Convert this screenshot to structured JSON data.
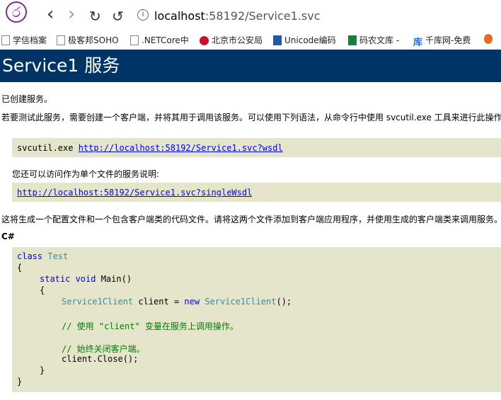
{
  "browser": {
    "logo_glyph": "ර",
    "back_icon": "‹",
    "forward_icon": "›",
    "reload_icon": "↻",
    "home_icon": "↺",
    "url_host": "localhost",
    "url_rest": ":58192/Service1.svc",
    "info_glyph": "i"
  },
  "bookmarks": [
    {
      "label": "学信档案",
      "icon": "doc"
    },
    {
      "label": "极客邦SOHO",
      "icon": "doc"
    },
    {
      "label": ".NETCore中",
      "icon": "doc"
    },
    {
      "label": "北京市公安局",
      "icon": "police"
    },
    {
      "label": "Unicode编码",
      "icon": "unicode"
    },
    {
      "label": "码农文库 -",
      "icon": "ma"
    },
    {
      "label": "千库网-免费",
      "icon": "qianku"
    }
  ],
  "page": {
    "title": "Service1 服务",
    "created": "已创建服务。",
    "instruction": "若要测试此服务，需要创建一个客户端，并将其用于调用该服务。可以使用下列语法，从命令行中使用 svcutil.exe 工具来进行此操作",
    "cmd_prefix": "svcutil.exe ",
    "wsdl_link": "http://localhost:58192/Service1.svc?wsdl",
    "single_note": "您还可以访问作为单个文件的服务说明:",
    "single_link": "http://localhost:58192/Service1.svc?singleWsdl",
    "generate_note": "这将生成一个配置文件和一个包含客户端类的代码文件。请将这两个文件添加到客户端应用程序，并使用生成的客户端类来调用服务。",
    "lang_heading": "C#"
  },
  "code": {
    "l1_kw": "class",
    "l1_ty": "Test",
    "l2": "{",
    "l3_kw": "static void",
    "l3_rest": " Main()",
    "l4": "{",
    "l5_ty": "Service1Client",
    "l5_mid": " client = ",
    "l5_kw": "new",
    "l5_ty2": "Service1Client",
    "l5_end": "();",
    "l6_cm": "// 使用 \"client\" 变量在服务上调用操作。",
    "l7_cm": "// 始终关闭客户端。",
    "l8": "client.Close();",
    "l9": "}",
    "l10": "}"
  },
  "colors": {
    "header_bg": "#003366",
    "box_bg": "#e5e5cc",
    "link": "#0000ff",
    "keyword": "#0000ff",
    "type": "#2b91af",
    "comment": "#008000"
  }
}
